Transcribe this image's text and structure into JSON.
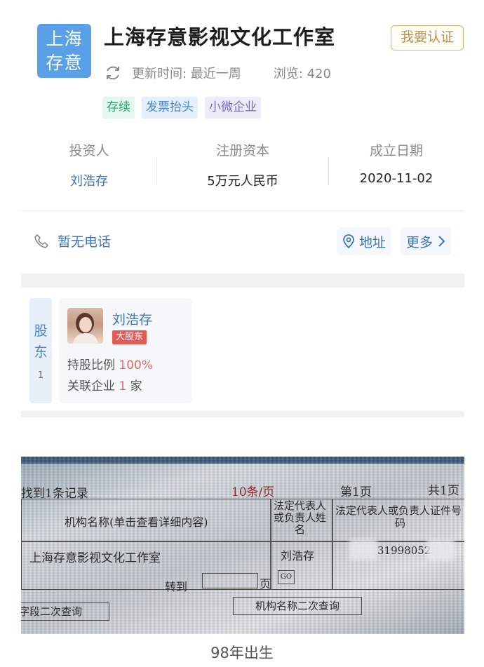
{
  "header": {
    "logo_lines": [
      "上海",
      "存意"
    ],
    "company_name": "上海存意影视文化工作室",
    "certify_label": "我要认证",
    "update_time": "更新时间: 最近一周",
    "views": "浏览: 420"
  },
  "tags": [
    {
      "label": "存续",
      "color": "#2aa86f"
    },
    {
      "label": "发票抬头",
      "color": "#4a86cf"
    },
    {
      "label": "小微企业",
      "color": "#7868b8"
    }
  ],
  "stats": [
    {
      "label": "投资人",
      "value": "刘浩存"
    },
    {
      "label": "注册资本",
      "value": "5万元人民币"
    },
    {
      "label": "成立日期",
      "value": "2020-11-02"
    }
  ],
  "contact": {
    "phone": "暂无电话",
    "address_label": "地址",
    "more_label": "更多"
  },
  "shareholders": {
    "tab_label": [
      "股",
      "东"
    ],
    "count": "1",
    "items": [
      {
        "name": "刘浩存",
        "badge": "大股东",
        "ratio_label": "持股比例",
        "ratio_value": "100%",
        "related_label": "关联企业",
        "related_count": "1",
        "related_unit": "家"
      }
    ]
  },
  "photo": {
    "record_text": "找到1条记录",
    "per_page": "10条/页",
    "page_current": "第1页",
    "page_total": "共1页",
    "col_org": "机构名称(单击查看详细内容)",
    "col_rep": [
      "法定代表人",
      "或负责人姓",
      "名"
    ],
    "col_id": [
      "法定代表人或负责人证件号",
      "码"
    ],
    "row_org": "上海存意影视文化工作室",
    "row_rep": "刘浩存",
    "row_id": "31998052",
    "goto_label": "转到",
    "page_suffix": "页",
    "go_btn": "GO",
    "btn_left": "字段二次查询",
    "btn_right": "机构名称二次查询"
  },
  "caption": "98年出生",
  "colors": {
    "link_blue": "#3d74b8",
    "logo_blue": "#5aa0e6",
    "certify_gold": "#c0914a",
    "badge_red": "#e35b56"
  }
}
